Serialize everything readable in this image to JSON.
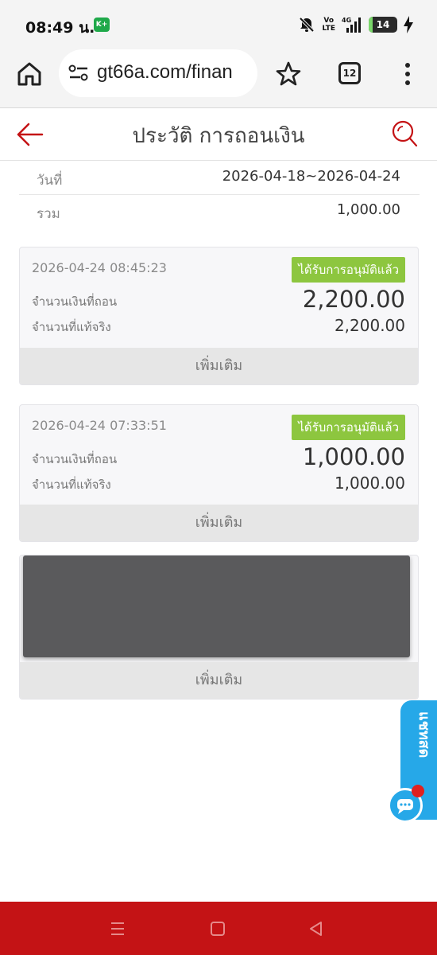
{
  "status": {
    "time": "08:49 น.",
    "app_badge": "K+",
    "network_label_top": "Vo",
    "network_label_bottom": "LTE",
    "network_gen": "4G",
    "battery": "14",
    "battery_level": 0.14
  },
  "browser": {
    "url": "gt66a.com/finan",
    "tab_count": "12"
  },
  "page": {
    "title": "ประวัติ การถอนเงิน"
  },
  "summary": {
    "date_label": "วันที่",
    "date_value": "2026-04-18~2026-04-24",
    "total_label": "รวม",
    "total_value": "1,000.00"
  },
  "records": [
    {
      "datetime": "2026-04-24 08:45:23",
      "status": "ได้รับการอนุมัติแล้ว",
      "amount_label": "จำนวนเงินที่ถอน",
      "amount": "2,200.00",
      "actual_label": "จำนวนที่แท้จริง",
      "actual": "2,200.00",
      "more": "เพิ่มเติม"
    },
    {
      "datetime": "2026-04-24 07:33:51",
      "status": "ได้รับการอนุมัติแล้ว",
      "amount_label": "จำนวนเงินที่ถอน",
      "amount": "1,000.00",
      "actual_label": "จำนวนที่แท้จริง",
      "actual": "1,000.00",
      "more": "เพิ่มเติม"
    },
    {
      "more": "เพิ่มเติม"
    }
  ],
  "livechat": {
    "label": "แชทสด"
  },
  "colors": {
    "brand_red": "#c41315",
    "approved_green": "#8dc63f",
    "chat_blue": "#26a8e8"
  }
}
